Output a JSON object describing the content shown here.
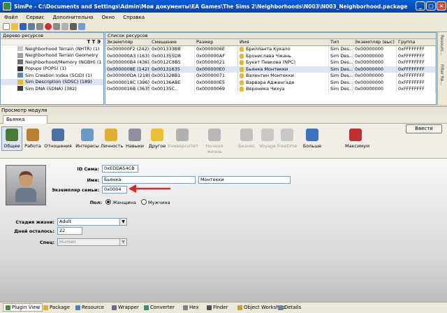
{
  "window": {
    "title": "SimPe - C:\\Documents and Settings\\Admin\\Мои документы\\EA Games\\The Sims 2\\Neighborhoods\\N003\\N003_Neighborhood.package"
  },
  "menu": [
    "Файл",
    "Сервис",
    "Дополнительно",
    "Окно",
    "Справка"
  ],
  "tree": {
    "title": "Дерево ресурсов",
    "items": [
      "Neighborhood Terrain (NHTR) (1)",
      "Neighborhood Terrain Geometry",
      "Neighborhood/Memory (NGBH) (1",
      "Popups (POPS) (1)",
      "Sim Creation Index (SCID) (1)",
      "Sim Description (SDSC) (189)",
      "Sim DNA (SDNA) (382)"
    ]
  },
  "list": {
    "title": "Список ресурсов",
    "columns": [
      "Экземпляр",
      "Смещение",
      "Размер",
      "Имя",
      "Тип",
      "Экземпляр (выс)",
      "Группа"
    ],
    "rows": [
      [
        "0x000000F2 (242)",
        "0x001333B8",
        "0x0000006E",
        "Брилланта Кукало",
        "Sim Des...",
        "0x00000000",
        "0xFFFFFFFF"
      ],
      [
        "0x000000A3 (163)",
        "0x001355D8",
        "0x000000AF",
        "Бронислава Чжань",
        "Sim Des...",
        "0x00000000",
        "0xFFFFFFFF"
      ],
      [
        "0x000000B4 (436)",
        "0x0012C8B5",
        "0x00000021",
        "Букет Певкова (NPC)",
        "Sim Des...",
        "0x00000000",
        "0xFFFFFFFF"
      ],
      [
        "0x0000008E (142)",
        "0x00131635",
        "0x000000E0",
        "Бьянка Монтекки",
        "Sim Des...",
        "0x00000000",
        "0xFFFFFFFF"
      ],
      [
        "0x000000DA (218)",
        "0x001328B1",
        "0x00000071",
        "Валентин Монтекки",
        "Sim Des...",
        "0x00000000",
        "0xFFFFFFFF"
      ],
      [
        "0x0000018C (396)",
        "0x00136ABE",
        "0x000000E5",
        "Варвара Адженгаде",
        "Sim Des...",
        "0x00000000",
        "0xFFFFFFFF"
      ],
      [
        "0x0000016B (363)",
        "0x00135C..",
        "0x00000069",
        "Вероника Чихуа",
        "Sim Des...",
        "0x00000000",
        "0xFFFFFFFF"
      ]
    ]
  },
  "sidebar": [
    "Resourc...",
    "Filter Re..."
  ],
  "module": {
    "header": "Просмотр модуля",
    "doc_tab": "Бьянка Монтекки",
    "commit": "Ввести"
  },
  "modbuttons": [
    "Общее",
    "Работа",
    "Отношения",
    "Интересы",
    "Личность",
    "Навыки",
    "Другое",
    "Университет",
    "Ночная жизнь",
    "Бизнес",
    "Voyage",
    "Freetime",
    "Больше",
    "Максимум"
  ],
  "form": {
    "sim_id_label": "ID Сима:",
    "sim_id": "0xEDDA54CB",
    "name_label": "Имя:",
    "first_name": "Бьянка",
    "last_name": "Монтекки",
    "family_label": "Экземпляр семьи:",
    "family": "0x0004",
    "gender_label": "Пол:",
    "female": "Женщина",
    "male": "Мужчина",
    "life_label": "Стадия жизни:",
    "life": "Adult",
    "days_label": "Дней осталось:",
    "days": "22",
    "species_label": "Спец:",
    "species": "Human"
  },
  "status_tabs": [
    "Plugin View",
    "Package",
    "Resource",
    "Wrapper",
    "Converter",
    "Hex",
    "Finder",
    "Object Workshop",
    "Details"
  ],
  "colors": {
    "title_bg": "#0a5fd8",
    "arrow": "#d8262a",
    "selected_row": "#dde4f4"
  }
}
